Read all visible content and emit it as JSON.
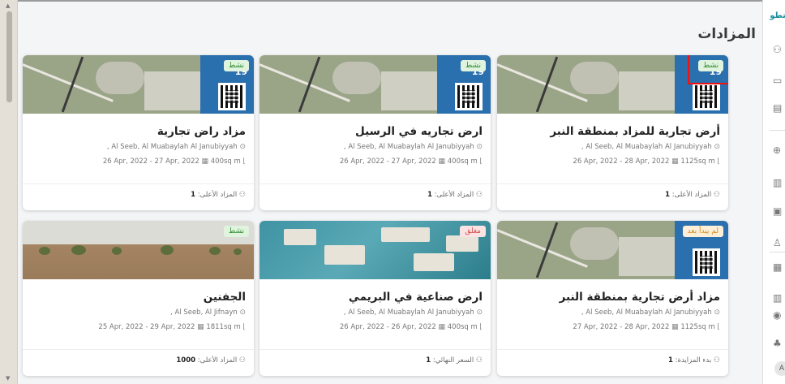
{
  "page": {
    "title": "المزادات"
  },
  "sidebar": {
    "tab_label": "تطو",
    "icons": [
      "users-icon",
      "id-card-icon",
      "card-icon",
      "globe-icon",
      "building-icon",
      "document-icon",
      "person-icon",
      "gallery-icon",
      "buildings-icon",
      "circle-icon",
      "bell-icon"
    ],
    "avatar": "A"
  },
  "cards": [
    {
      "status": "نشط",
      "status_type": "active",
      "image": "map",
      "image_number": "19",
      "title": "أرض تجارية للمزاد بمنطقة النبر",
      "location": "Al Seeb, Al Muabaylah Al Janubiyyah ,",
      "dates": "26 Apr, 2022 - 28 Apr, 2022",
      "area": "1125sq m",
      "bid_label": "المزاد الأعلى:",
      "bid_value": "1"
    },
    {
      "status": "نشط",
      "status_type": "active",
      "image": "map",
      "image_number": "19",
      "title": "ارض تجاريه في الرسيل",
      "location": "Al Seeb, Al Muabaylah Al Janubiyyah ,",
      "dates": "26 Apr, 2022 - 27 Apr, 2022",
      "area": "400sq m",
      "bid_label": "المزاد الأعلى:",
      "bid_value": "1"
    },
    {
      "status": "نشط",
      "status_type": "active",
      "image": "map",
      "image_number": "19",
      "title": "مزاد راض تجارية",
      "location": "Al Seeb, Al Muabaylah Al Janubiyyah ,",
      "dates": "26 Apr, 2022 - 27 Apr, 2022",
      "area": "400sq m",
      "bid_label": "المزاد الأعلى:",
      "bid_value": "1"
    },
    {
      "status": "لم يبدأ بعد",
      "status_type": "pending",
      "image": "map",
      "image_number": "",
      "title": "مزاد أرض تجارية بمنطقة النبر",
      "location": "Al Seeb, Al Muabaylah Al Janubiyyah ,",
      "dates": "27 Apr, 2022 - 28 Apr, 2022",
      "area": "1125sq m",
      "bid_label": "بدء المزايدة:",
      "bid_value": "1"
    },
    {
      "status": "مغلق",
      "status_type": "closed",
      "image": "city",
      "image_number": "",
      "title": "ارض صناعية في البريمي",
      "location": "Al Seeb, Al Muabaylah Al Janubiyyah ,",
      "dates": "26 Apr, 2022 - 26 Apr, 2022",
      "area": "400sq m",
      "bid_label": "السعر النهائي:",
      "bid_value": "1"
    },
    {
      "status": "نشط",
      "status_type": "active",
      "image": "desert",
      "image_number": "",
      "title": "الجفنين",
      "location": "Al Seeb, Al Jifnayn ,",
      "dates": "25 Apr, 2022 - 29 Apr, 2022",
      "area": "1811sq m",
      "bid_label": "المزاد الأعلى:",
      "bid_value": "1000"
    }
  ]
}
